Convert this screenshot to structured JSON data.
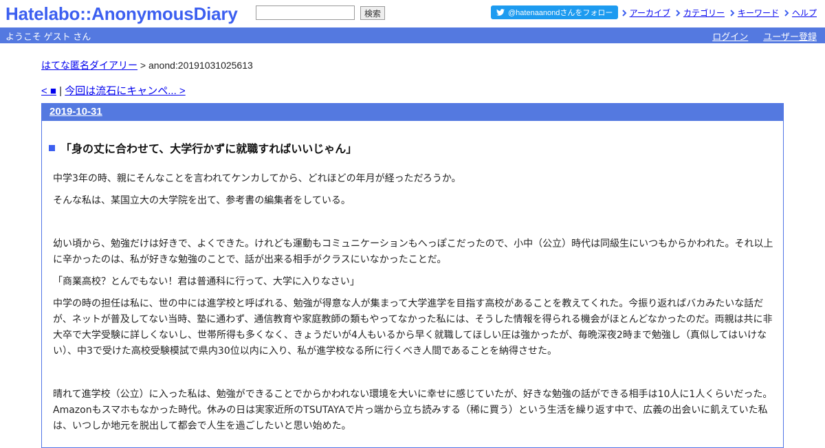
{
  "header": {
    "logo": "Hatelabo::AnonymousDiary",
    "search_placeholder": "",
    "search_button": "検索",
    "twitter_label": "@hatenaanondさんをフォロー",
    "links": [
      "アーカイブ",
      "カテゴリー",
      "キーワード",
      "ヘルプ"
    ]
  },
  "strip": {
    "welcome": "ようこそ ゲスト さん",
    "login": "ログイン",
    "register": "ユーザー登録"
  },
  "breadcrumb": {
    "root": "はてな匿名ダイアリー",
    "sep": " > ",
    "current": "anond:20191031025613"
  },
  "nav": {
    "prev": "< ■",
    "sep": " | ",
    "next": "今回は流石にキャンペ... >"
  },
  "entry": {
    "date": "2019-10-31",
    "title": "「身の丈に合わせて、大学行かずに就職すればいいじゃん」",
    "paragraphs": [
      "中学3年の時、親にそんなことを言われてケンカしてから、どれほどの年月が経っただろうか。",
      "そんな私は、某国立大の大学院を出て、参考書の編集者をしている。",
      "",
      "幼い頃から、勉強だけは好きで、よくできた。けれども運動もコミュニケーションもへっぽこだったので、小中（公立）時代は同級生にいつもからかわれた。それ以上に辛かったのは、私が好きな勉強のことで、話が出来る相手がクラスにいなかったことだ。",
      "「商業高校？とんでもない！君は普通科に行って、大学に入りなさい」",
      "中学の時の担任は私に、世の中には進学校と呼ばれる、勉強が得意な人が集まって大学進学を目指す高校があることを教えてくれた。今振り返ればバカみたいな話だが、ネットが普及してない当時、塾に通わず、通信教育や家庭教師の類もやってなかった私には、そうした情報を得られる機会がほとんどなかったのだ。両親は共に非大卒で大学受験に詳しくないし、世帯所得も多くなく、きょうだいが4人もいるから早く就職してほしい圧は強かったが、毎晩深夜2時まで勉強し（真似してはいけない）、中3で受けた高校受験模試で県内30位以内に入り、私が進学校なる所に行くべき人間であることを納得させた。",
      "",
      "晴れて進学校（公立）に入った私は、勉強ができることでからかわれない環境を大いに幸せに感じていたが、好きな勉強の話ができる相手は10人に1人くらいだった。Amazonもスマホもなかった時代。休みの日は実家近所のTSUTAYAで片っ端から立ち読みする（稀に買う）という生活を繰り返す中で、広義の出会いに飢えていた私は、いつしか地元を脱出して都会で人生を過ごしたいと思い始めた。"
    ]
  }
}
